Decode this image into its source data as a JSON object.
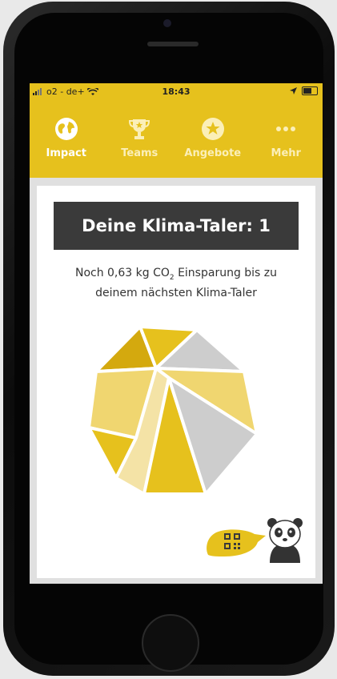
{
  "statusbar": {
    "carrier": "o2 - de+",
    "time": "18:43"
  },
  "tabs": [
    {
      "label": "Impact",
      "icon": "globe-icon",
      "active": true
    },
    {
      "label": "Teams",
      "icon": "trophy-icon",
      "active": false
    },
    {
      "label": "Angebote",
      "icon": "star-icon",
      "active": false
    },
    {
      "label": "Mehr",
      "icon": "more-dots-icon",
      "active": false
    }
  ],
  "card": {
    "title": "Deine Klima-Taler: 1",
    "subtitle_line1_a": "Noch 0,63 kg CO",
    "subtitle_line1_sub": "2",
    "subtitle_line1_b": " Einsparung bis zu",
    "subtitle_line2": "deinem nächsten Klima-Taler"
  },
  "colors": {
    "brand_yellow": "#e6c11d",
    "banner_dark": "#3a3a3a",
    "gold": "#d4a90e",
    "light_yellow": "#f0d670",
    "pale_yellow": "#f4e3a6",
    "gray_segment": "#cdcdcd"
  }
}
